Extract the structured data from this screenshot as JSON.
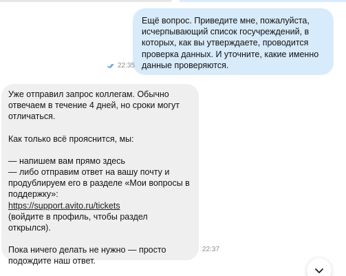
{
  "chat": {
    "outgoing": {
      "text": "Ещё вопрос. Приведите мне, пожалуйста,\nисчерпывающий список госучреждений, в\nкоторых, как вы утверждаете, проводится\nпроверка данных. И уточните, какие именно\nданные проверяются.",
      "time": "22:35",
      "status_icon": "double-check-icon"
    },
    "incoming": {
      "p1": "Уже отправил запрос коллегам. Обычно\nотвечаем в течение 4 дней, но сроки могут\nотличаться.",
      "p2": "Как только всё прояснится, мы:",
      "p3": "— напишем вам прямо здесь\n— либо отправим ответ на вашу почту и\nпродублируем его в разделе «Мои вопросы в\nподдержку»:",
      "link": "https://support.avito.ru/tickets",
      "p4": "(войдите в профиль, чтобы раздел открылся).",
      "p5": "Пока ничего делать не нужно — просто\nподождите наш ответ.",
      "time": "22:37"
    },
    "scroll_button_icon": "chevron-down-icon"
  },
  "colors": {
    "outgoing_bubble": "#d8ebfb",
    "incoming_bubble": "#efefef",
    "tick": "#4a90e2",
    "time": "#8c8c8c"
  }
}
